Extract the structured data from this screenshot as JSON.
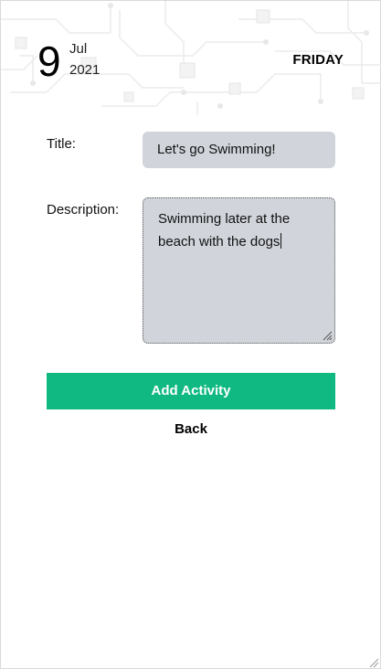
{
  "date": {
    "day": "9",
    "month": "Jul",
    "year": "2021",
    "weekday": "FRIDAY"
  },
  "form": {
    "title_label": "Title:",
    "title_value": "Let's go Swimming!",
    "description_label": "Description:",
    "description_value": "Swimming later at the beach with the dogs"
  },
  "actions": {
    "add_label": "Add Activity",
    "back_label": "Back"
  },
  "colors": {
    "accent": "#10b981",
    "input_bg": "#d1d5db"
  },
  "icons": {
    "textarea_resize": "resize-grip-icon",
    "page_resize": "resize-grip-icon",
    "header_background": "circuit-pattern"
  }
}
